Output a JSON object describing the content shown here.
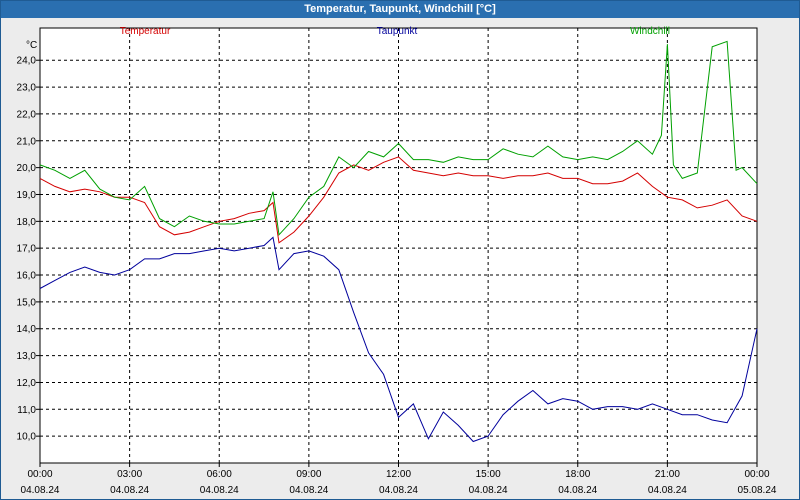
{
  "window": {
    "title": "Temperatur, Taupunkt, Windchill [°C]"
  },
  "chart_data": {
    "type": "line",
    "title": "Temperatur, Taupunkt, Windchill [°C]",
    "ylabel": "°C",
    "ylim": [
      9.0,
      25.2
    ],
    "yticks": [
      "10,0",
      "11,0",
      "12,0",
      "13,0",
      "14,0",
      "15,0",
      "16,0",
      "17,0",
      "18,0",
      "19,0",
      "20,0",
      "21,0",
      "22,0",
      "23,0",
      "24,0"
    ],
    "xlim": [
      0,
      24
    ],
    "xticks": [
      {
        "time": "00:00",
        "date": "04.08.24"
      },
      {
        "time": "03:00",
        "date": "04.08.24"
      },
      {
        "time": "06:00",
        "date": "04.08.24"
      },
      {
        "time": "09:00",
        "date": "04.08.24"
      },
      {
        "time": "12:00",
        "date": "04.08.24"
      },
      {
        "time": "15:00",
        "date": "04.08.24"
      },
      {
        "time": "18:00",
        "date": "04.08.24"
      },
      {
        "time": "21:00",
        "date": "04.08.24"
      },
      {
        "time": "00:00",
        "date": "05.08.24"
      }
    ],
    "grid": true,
    "legend_placement": "top",
    "series": [
      {
        "name": "Temperatur",
        "color": "#d40000",
        "x": [
          0,
          0.5,
          1,
          1.5,
          2,
          2.5,
          3,
          3.5,
          4,
          4.5,
          5,
          5.5,
          6,
          6.5,
          7,
          7.5,
          7.8,
          8,
          8.5,
          9,
          9.5,
          10,
          10.5,
          11,
          11.5,
          12,
          12.5,
          13,
          13.5,
          14,
          14.5,
          15,
          15.5,
          16,
          16.5,
          17,
          17.5,
          18,
          18.5,
          19,
          19.5,
          20,
          20.5,
          21,
          21.5,
          22,
          22.5,
          23,
          23.5,
          24
        ],
        "values": [
          19.6,
          19.3,
          19.1,
          19.2,
          19.1,
          18.9,
          18.9,
          18.7,
          17.8,
          17.5,
          17.6,
          17.8,
          18.0,
          18.1,
          18.3,
          18.4,
          18.7,
          17.2,
          17.6,
          18.2,
          18.9,
          19.8,
          20.1,
          19.9,
          20.2,
          20.4,
          19.9,
          19.8,
          19.7,
          19.8,
          19.7,
          19.7,
          19.6,
          19.7,
          19.7,
          19.8,
          19.6,
          19.6,
          19.4,
          19.4,
          19.5,
          19.8,
          19.3,
          18.9,
          18.8,
          18.5,
          18.6,
          18.8,
          18.2,
          18.0
        ]
      },
      {
        "name": "Taupunkt",
        "color": "#00009c",
        "x": [
          0,
          0.5,
          1,
          1.5,
          2,
          2.5,
          3,
          3.5,
          4,
          4.5,
          5,
          5.5,
          6,
          6.5,
          7,
          7.5,
          7.8,
          8,
          8.5,
          9,
          9.5,
          10,
          10.5,
          11,
          11.5,
          12,
          12.5,
          13,
          13.5,
          14,
          14.5,
          15,
          15.5,
          16,
          16.5,
          17,
          17.5,
          18,
          18.5,
          19,
          19.5,
          20,
          20.5,
          21,
          21.5,
          22,
          22.5,
          23,
          23.5,
          24
        ],
        "values": [
          15.5,
          15.8,
          16.1,
          16.3,
          16.1,
          16.0,
          16.2,
          16.6,
          16.6,
          16.8,
          16.8,
          16.9,
          17.0,
          16.9,
          17.0,
          17.1,
          17.4,
          16.2,
          16.8,
          16.9,
          16.7,
          16.2,
          14.6,
          13.1,
          12.3,
          10.7,
          11.2,
          9.9,
          10.9,
          10.4,
          9.8,
          10.0,
          10.8,
          11.3,
          11.7,
          11.2,
          11.4,
          11.3,
          11.0,
          11.1,
          11.1,
          11.0,
          11.2,
          11.0,
          10.8,
          10.8,
          10.6,
          10.5,
          11.5,
          14.0
        ]
      },
      {
        "name": "Windchill",
        "color": "#00a000",
        "x": [
          0,
          0.5,
          1,
          1.5,
          2,
          2.5,
          3,
          3.5,
          4,
          4.5,
          5,
          5.5,
          6,
          6.5,
          7,
          7.5,
          7.8,
          8,
          8.5,
          9,
          9.5,
          10,
          10.5,
          11,
          11.5,
          12,
          12.5,
          13,
          13.5,
          14,
          14.5,
          15,
          15.5,
          16,
          16.5,
          17,
          17.5,
          18,
          18.5,
          19,
          19.5,
          20,
          20.5,
          20.8,
          21,
          21.2,
          21.5,
          22,
          22.5,
          23,
          23.3,
          23.5,
          24
        ],
        "values": [
          20.1,
          19.9,
          19.6,
          19.9,
          19.2,
          18.9,
          18.8,
          19.3,
          18.1,
          17.8,
          18.2,
          18.0,
          17.9,
          17.9,
          18.0,
          18.1,
          19.1,
          17.5,
          18.1,
          18.9,
          19.3,
          20.4,
          20.0,
          20.6,
          20.4,
          20.9,
          20.3,
          20.3,
          20.2,
          20.4,
          20.3,
          20.3,
          20.7,
          20.5,
          20.4,
          20.8,
          20.4,
          20.3,
          20.4,
          20.3,
          20.6,
          21.0,
          20.5,
          21.2,
          24.6,
          20.1,
          19.6,
          19.8,
          24.5,
          24.7,
          19.9,
          20.0,
          19.4
        ]
      }
    ]
  }
}
